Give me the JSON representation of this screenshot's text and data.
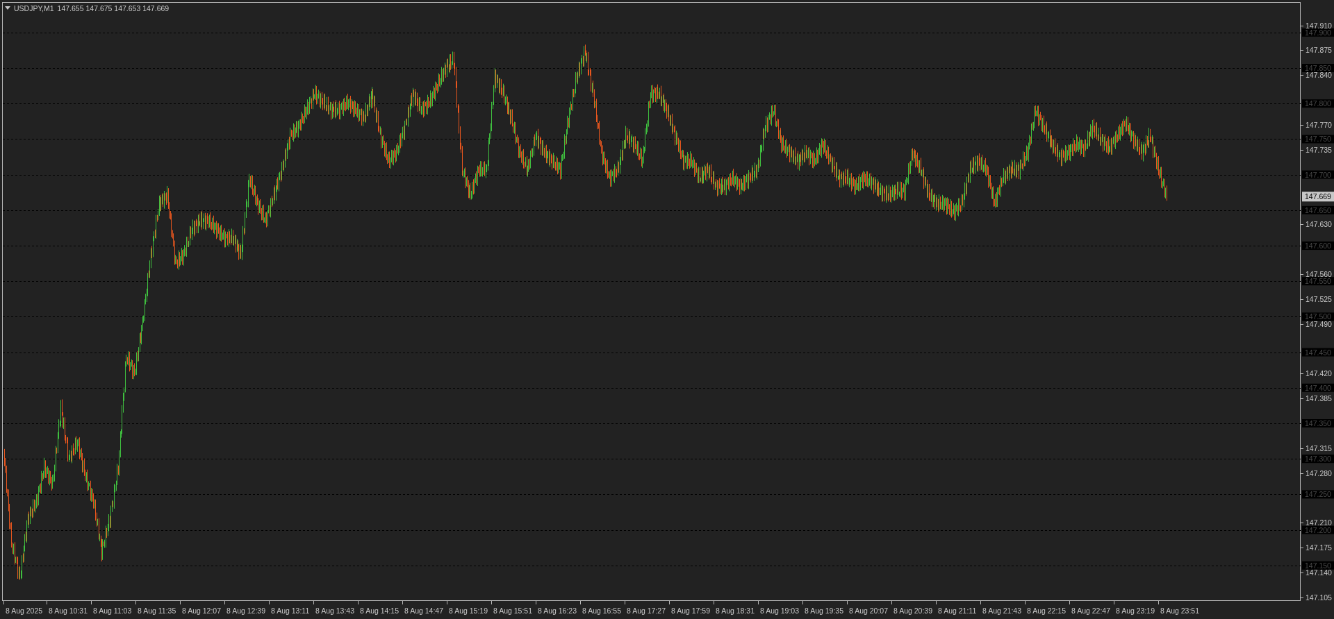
{
  "header": {
    "symbol": "USDJPY,M1",
    "ohlc": "147.655 147.675 147.653 147.669"
  },
  "chart": {
    "price_labels": [
      "147.910",
      "147.875",
      "147.840",
      "147.770",
      "147.735",
      "147.630",
      "147.560",
      "147.525",
      "147.490",
      "147.420",
      "147.385",
      "147.315",
      "147.280",
      "147.210",
      "147.175",
      "147.140",
      "147.105"
    ],
    "levels": [
      "147.900",
      "147.850",
      "147.800",
      "147.750",
      "147.700",
      "147.650",
      "147.600",
      "147.550",
      "147.500",
      "147.450",
      "147.400",
      "147.350",
      "147.300",
      "147.250",
      "147.200",
      "147.150"
    ],
    "current_price": "147.669",
    "time_labels": [
      "8 Aug 2025",
      "8 Aug 10:31",
      "8 Aug 11:03",
      "8 Aug 11:35",
      "8 Aug 12:07",
      "8 Aug 12:39",
      "8 Aug 13:11",
      "8 Aug 13:43",
      "8 Aug 14:15",
      "8 Aug 14:47",
      "8 Aug 15:19",
      "8 Aug 15:51",
      "8 Aug 16:23",
      "8 Aug 16:55",
      "8 Aug 17:27",
      "8 Aug 17:59",
      "8 Aug 18:31",
      "8 Aug 19:03",
      "8 Aug 19:35",
      "8 Aug 20:07",
      "8 Aug 20:39",
      "8 Aug 21:11",
      "8 Aug 21:43",
      "8 Aug 22:15",
      "8 Aug 22:47",
      "8 Aug 23:19",
      "8 Aug 23:51"
    ]
  }
}
